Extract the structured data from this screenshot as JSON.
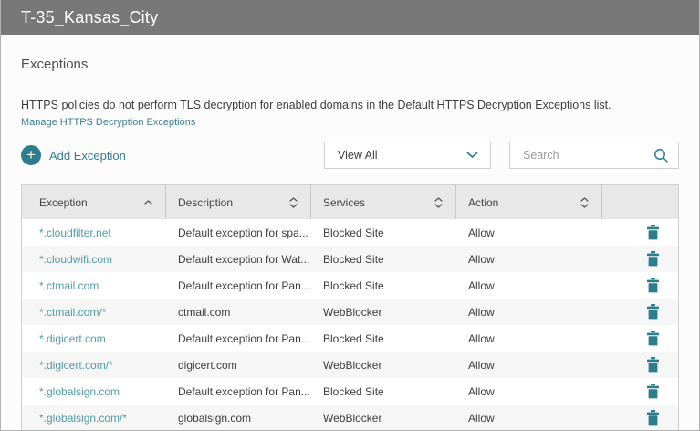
{
  "window": {
    "title": "T-35_Kansas_City"
  },
  "section": {
    "heading": "Exceptions",
    "description": "HTTPS policies do not perform TLS decryption for enabled domains in the Default HTTPS Decryption Exceptions list.",
    "manage_link": "Manage HTTPS Decryption Exceptions"
  },
  "toolbar": {
    "add_button": "Add Exception",
    "filter_value": "View All",
    "search_placeholder": "Search"
  },
  "table": {
    "columns": [
      {
        "label": "Exception",
        "sort": "asc"
      },
      {
        "label": "Description",
        "sort": "both"
      },
      {
        "label": "Services",
        "sort": "both"
      },
      {
        "label": "Action",
        "sort": "both"
      }
    ],
    "rows": [
      {
        "exception": "*.cloudfilter.net",
        "description": "Default exception for spa...",
        "services": "Blocked Site",
        "action": "Allow"
      },
      {
        "exception": "*.cloudwifi.com",
        "description": "Default exception for Wat...",
        "services": "Blocked Site",
        "action": "Allow"
      },
      {
        "exception": "*.ctmail.com",
        "description": "Default exception for Pan...",
        "services": "Blocked Site",
        "action": "Allow"
      },
      {
        "exception": "*.ctmail.com/*",
        "description": "ctmail.com",
        "services": "WebBlocker",
        "action": "Allow"
      },
      {
        "exception": "*.digicert.com",
        "description": "Default exception for Pan...",
        "services": "Blocked Site",
        "action": "Allow"
      },
      {
        "exception": "*.digicert.com/*",
        "description": "digicert.com",
        "services": "WebBlocker",
        "action": "Allow"
      },
      {
        "exception": "*.globalsign.com",
        "description": "Default exception for Pan...",
        "services": "Blocked Site",
        "action": "Allow"
      },
      {
        "exception": "*.globalsign.com/*",
        "description": "globalsign.com",
        "services": "WebBlocker",
        "action": "Allow"
      }
    ]
  },
  "colors": {
    "accent_teal": "#2e7d8d",
    "link_teal": "#3c7f90",
    "domain_teal": "#529aa6",
    "titlebar_gray": "#787878",
    "header_row_gray": "#e8e8e8"
  }
}
